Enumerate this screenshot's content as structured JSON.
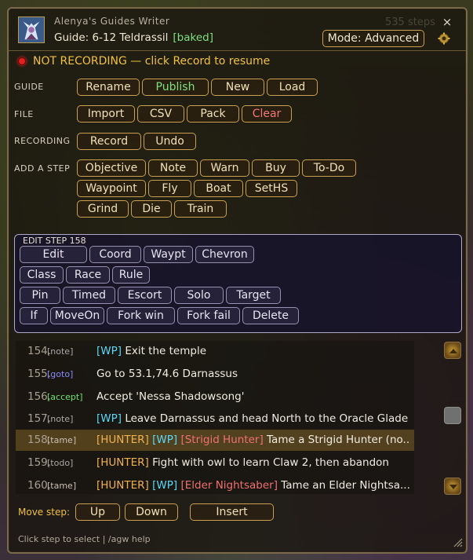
{
  "window": {
    "app_name": "Alenya's Guides Writer",
    "guide_label": "Guide: 6-12 Teldrassil",
    "guide_tag": "[baked]",
    "steps_ghost": "535 steps",
    "close_glyph": "×",
    "mode_label": "Mode: Advanced"
  },
  "recording": {
    "status_text": "NOT RECORDING — click Record to resume"
  },
  "sections": {
    "guide": "GUIDE",
    "file": "FILE",
    "recording": "RECORDING",
    "add_step": "ADD A STEP"
  },
  "buttons": {
    "guide": [
      "Rename",
      "Publish",
      "New",
      "Load"
    ],
    "file": [
      "Import",
      "CSV",
      "Pack",
      "Clear"
    ],
    "recording": [
      "Record",
      "Undo"
    ],
    "add_step_row1": [
      "Objective",
      "Note",
      "Warn",
      "Buy",
      "To-Do"
    ],
    "add_step_row2": [
      "Waypoint",
      "Fly",
      "Boat",
      "SetHS"
    ],
    "add_step_row3": [
      "Grind",
      "Die",
      "Train"
    ]
  },
  "edit_panel": {
    "title": "EDIT STEP 158",
    "row1": [
      "Edit",
      "Coord",
      "Waypt",
      "Chevron"
    ],
    "row2": [
      "Class",
      "Race",
      "Rule"
    ],
    "row3": [
      "Pin",
      "Timed",
      "Escort",
      "Solo",
      "Target"
    ],
    "row4": [
      "If",
      "MoveOn",
      "Fork win",
      "Fork fail",
      "Delete"
    ]
  },
  "steps": [
    {
      "num": "154.",
      "tag": "[note]",
      "parts": [
        {
          "t": "[WP]",
          "c": "wp"
        },
        {
          "t": " Exit the temple",
          "c": ""
        }
      ]
    },
    {
      "num": "155.",
      "tag": "[goto]",
      "parts": [
        {
          "t": "Go to 53.1,74.6 Darnassus",
          "c": ""
        }
      ]
    },
    {
      "num": "156.",
      "tag": "[accept]",
      "parts": [
        {
          "t": "Accept 'Nessa Shadowsong'",
          "c": ""
        }
      ]
    },
    {
      "num": "157.",
      "tag": "[note]",
      "parts": [
        {
          "t": "[WP]",
          "c": "wp"
        },
        {
          "t": " Leave Darnassus and head North to the Oracle Glade",
          "c": ""
        }
      ]
    },
    {
      "num": "158.",
      "tag": "[tame]",
      "parts": [
        {
          "t": "[HUNTER]",
          "c": "hunter"
        },
        {
          "t": " [WP]",
          "c": "wp"
        },
        {
          "t": " [Strigid Hunter]",
          "c": "npc"
        },
        {
          "t": " Tame a Strigid Hunter (no...",
          "c": ""
        }
      ]
    },
    {
      "num": "159.",
      "tag": "[todo]",
      "parts": [
        {
          "t": "[HUNTER]",
          "c": "hunter"
        },
        {
          "t": " Fight with owl to learn Claw 2, then abandon",
          "c": ""
        }
      ]
    },
    {
      "num": "160.",
      "tag": "[tame]",
      "parts": [
        {
          "t": "[HUNTER]",
          "c": "hunter"
        },
        {
          "t": " [WP]",
          "c": "wp"
        },
        {
          "t": " [Elder Nightsaber]",
          "c": "npc"
        },
        {
          "t": " Tame an Elder Nightsa...",
          "c": ""
        }
      ]
    }
  ],
  "selected_step": 158,
  "move": {
    "label": "Move step:",
    "buttons": [
      "Up",
      "Down",
      "Insert"
    ]
  },
  "footer": "Click step to select | /agw help",
  "colors": {
    "gold_border": "#c8a050",
    "publish_green": "#7ee07e",
    "clear_red": "#f07878",
    "waypoint_cyan": "#5ad8f8",
    "hunter_orange": "#f0b050",
    "npc_red": "#f07070",
    "record_yellow": "#f0c040"
  }
}
